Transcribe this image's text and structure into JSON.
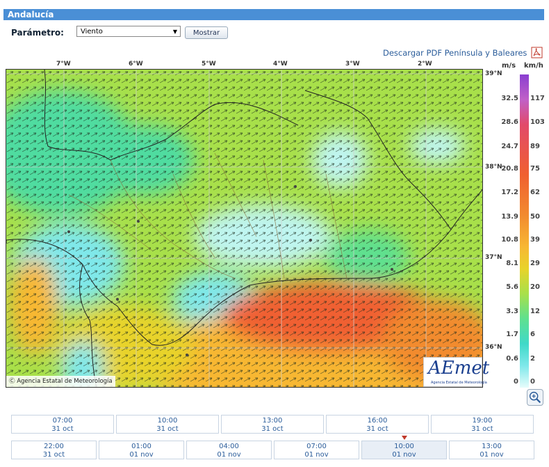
{
  "header": {
    "title": "Andalucía"
  },
  "controls": {
    "param_label": "Parámetro:",
    "select_value": "Viento",
    "show_button": "Mostrar",
    "pdf_link": "Descargar PDF Península y Baleares"
  },
  "map": {
    "lon_labels": [
      "7°W",
      "6°W",
      "5°W",
      "4°W",
      "3°W",
      "2°W"
    ],
    "lat_labels": [
      "39°N",
      "38°N",
      "37°N",
      "36°N"
    ],
    "copyright": "Agencia Estatal de Meteorología",
    "logo_text": "AEmet",
    "logo_sub": "Agencia Estatal de Meteorología"
  },
  "legend": {
    "unit_ms": "m/s",
    "unit_kmh": "km/h",
    "ms_values": [
      "32.5",
      "28.6",
      "24.7",
      "20.8",
      "17.2",
      "13.9",
      "10.8",
      "8.1",
      "5.6",
      "3.3",
      "1.7",
      "0.6",
      "0"
    ],
    "kmh_values": [
      "117",
      "103",
      "89",
      "75",
      "62",
      "50",
      "39",
      "29",
      "20",
      "12",
      "6",
      "2",
      "0"
    ],
    "colors": [
      "#8a3fd0",
      "#c060c8",
      "#e24a6a",
      "#f06030",
      "#f28b2f",
      "#f7b733",
      "#e8d32a",
      "#a8e04a",
      "#5fe08f",
      "#3fd9c8",
      "#7fe8ea",
      "#bff5f0",
      "#e6fcfb"
    ]
  },
  "timeline": {
    "row1": [
      {
        "time": "07:00",
        "date": "31 oct"
      },
      {
        "time": "10:00",
        "date": "31 oct"
      },
      {
        "time": "13:00",
        "date": "31 oct"
      },
      {
        "time": "16:00",
        "date": "31 oct"
      },
      {
        "time": "19:00",
        "date": "31 oct"
      }
    ],
    "row2": [
      {
        "time": "22:00",
        "date": "31 oct"
      },
      {
        "time": "01:00",
        "date": "01 nov"
      },
      {
        "time": "04:00",
        "date": "01 nov"
      },
      {
        "time": "07:00",
        "date": "01 nov"
      },
      {
        "time": "10:00",
        "date": "01 nov"
      },
      {
        "time": "13:00",
        "date": "01 nov"
      }
    ],
    "active_index_row2": 4
  },
  "colors": {
    "accent": "#4a8fd6",
    "link": "#2a5c9a"
  }
}
